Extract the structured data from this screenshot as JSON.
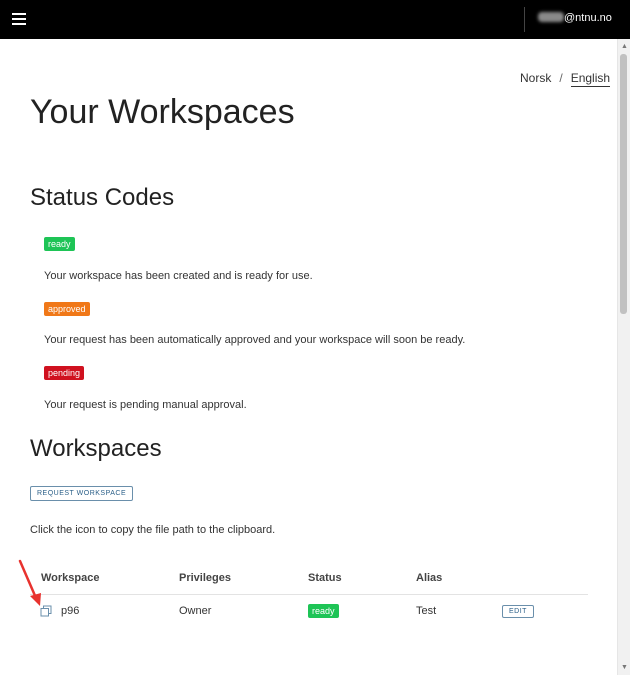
{
  "header": {
    "user_email": "@ntnu.no"
  },
  "language": {
    "norsk": "Norsk",
    "separator": "/",
    "english": "English"
  },
  "page_title": "Your Workspaces",
  "status_codes": {
    "heading": "Status Codes",
    "items": [
      {
        "badge": "ready",
        "description": "Your workspace has been created and is ready for use.",
        "color": "#1ec456"
      },
      {
        "badge": "approved",
        "description": "Your request has been automatically approved and your workspace will soon be ready.",
        "color": "#f07818"
      },
      {
        "badge": "pending",
        "description": "Your request is pending manual approval.",
        "color": "#d0111f"
      }
    ]
  },
  "workspaces": {
    "heading": "Workspaces",
    "request_button": "REQUEST WORKSPACE",
    "hint": "Click the icon to copy the file path to the clipboard.",
    "columns": [
      "Workspace",
      "Privileges",
      "Status",
      "Alias"
    ],
    "rows": [
      {
        "workspace": "p96",
        "privileges": "Owner",
        "status": "ready",
        "alias": "Test",
        "action": "EDIT"
      }
    ]
  }
}
